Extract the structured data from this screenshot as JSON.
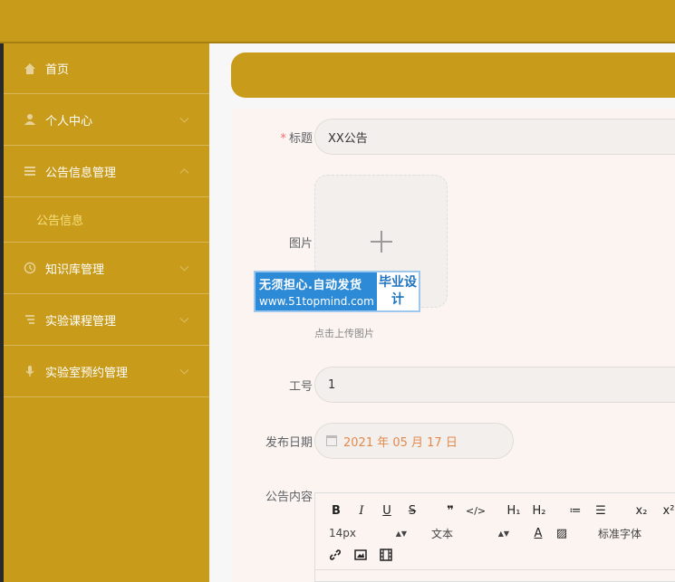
{
  "sidebar": {
    "items": [
      {
        "label": "首页",
        "icon": "home-icon"
      },
      {
        "label": "个人中心",
        "icon": "user-icon"
      },
      {
        "label": "公告信息管理",
        "icon": "list-icon"
      },
      {
        "label": "知识库管理",
        "icon": "clock-icon"
      },
      {
        "label": "实验课程管理",
        "icon": "tag-icon"
      },
      {
        "label": "实验室预约管理",
        "icon": "mic-icon"
      }
    ],
    "sub_item": "公告信息"
  },
  "form": {
    "title_label": "标题",
    "title_required": "*",
    "title_value": "XX公告",
    "image_label": "图片",
    "upload_tip": "点击上传图片",
    "worker_label": "工号",
    "worker_value": "1",
    "date_label": "发布日期",
    "date_value": "2021 年 05 月 17 日",
    "content_label": "公告内容"
  },
  "editor": {
    "buttons": [
      "B",
      "I",
      "U",
      "S",
      "❞",
      "</>",
      "H₁",
      "H₂",
      "≔",
      "☰",
      "x₂",
      "x²"
    ],
    "font_size": "14px",
    "block_type": "文本",
    "font_family": "标准字体"
  },
  "watermark": {
    "line1": "无须担心.自动发货",
    "line2": "www.51topmind.com",
    "tag": "毕业设计"
  }
}
